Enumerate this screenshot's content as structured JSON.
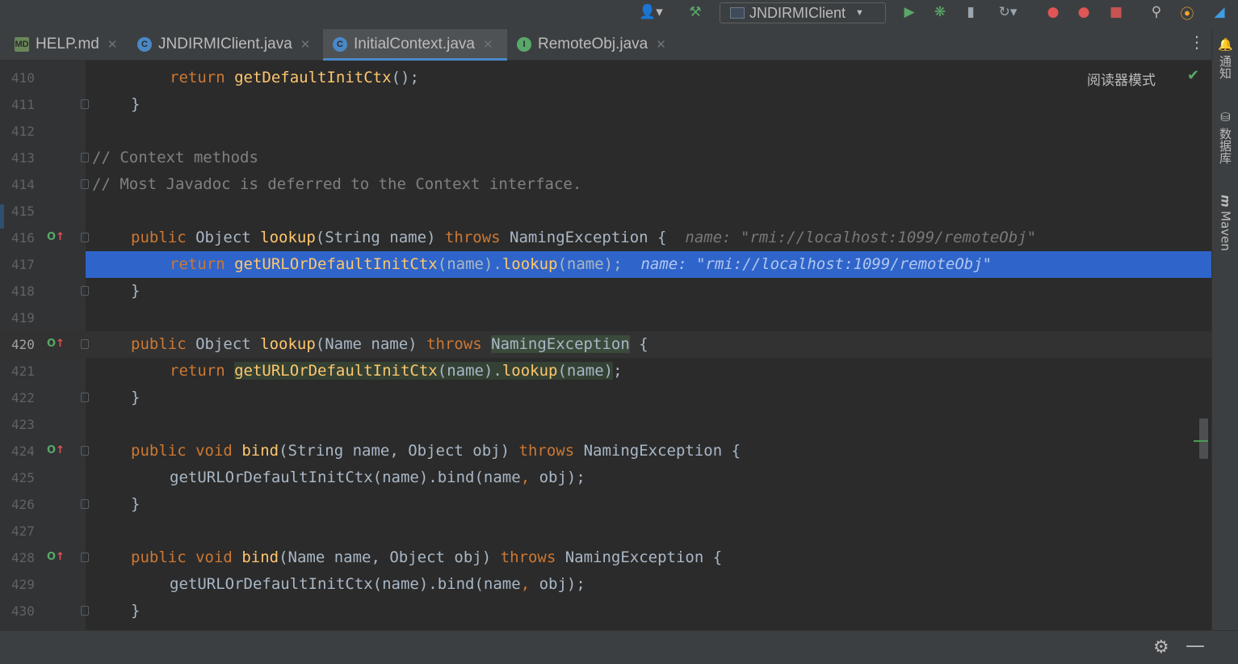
{
  "toolbar": {
    "run_config": "JNDIRMIClient"
  },
  "tabs": [
    {
      "label": "HELP.md",
      "icon": "markdown-icon",
      "icon_text": "MD",
      "icon_color": "#6a8759"
    },
    {
      "label": "JNDIRMIClient.java",
      "icon": "class-icon",
      "icon_text": "C",
      "icon_color": "#4a88c7"
    },
    {
      "label": "InitialContext.java",
      "icon": "class-icon",
      "icon_text": "C",
      "icon_color": "#4a88c7",
      "active": true
    },
    {
      "label": "RemoteObj.java",
      "icon": "interface-icon",
      "icon_text": "I",
      "icon_color": "#59a869"
    }
  ],
  "right_strip": {
    "notifications": "通知",
    "database": "数据库",
    "maven": "Maven"
  },
  "editor": {
    "reader_mode": "阅读器模式",
    "lines": [
      {
        "n": "410",
        "code": "        return getDefaultInitCtx();"
      },
      {
        "n": "411",
        "code": "    }"
      },
      {
        "n": "412",
        "code": ""
      },
      {
        "n": "413",
        "code": "// Context methods"
      },
      {
        "n": "414",
        "code": "// Most Javadoc is deferred to the Context interface."
      },
      {
        "n": "415",
        "code": ""
      },
      {
        "n": "416",
        "code": "    public Object lookup(String name) throws NamingException {",
        "hint": "name: \"rmi://localhost:1099/remoteObj\""
      },
      {
        "n": "417",
        "code": "        return getURLOrDefaultInitCtx(name).lookup(name);",
        "hint": "name: \"rmi://localhost:1099/remoteObj\""
      },
      {
        "n": "418",
        "code": "    }"
      },
      {
        "n": "419",
        "code": ""
      },
      {
        "n": "420",
        "code": "    public Object lookup(Name name) throws NamingException {"
      },
      {
        "n": "421",
        "code": "        return getURLOrDefaultInitCtx(name).lookup(name);"
      },
      {
        "n": "422",
        "code": "    }"
      },
      {
        "n": "423",
        "code": ""
      },
      {
        "n": "424",
        "code": "    public void bind(String name, Object obj) throws NamingException {"
      },
      {
        "n": "425",
        "code": "        getURLOrDefaultInitCtx(name).bind(name, obj);"
      },
      {
        "n": "426",
        "code": "    }"
      },
      {
        "n": "427",
        "code": ""
      },
      {
        "n": "428",
        "code": "    public void bind(Name name, Object obj) throws NamingException {"
      },
      {
        "n": "429",
        "code": "        getURLOrDefaultInitCtx(name).bind(name, obj);"
      },
      {
        "n": "430",
        "code": "    }"
      }
    ]
  }
}
